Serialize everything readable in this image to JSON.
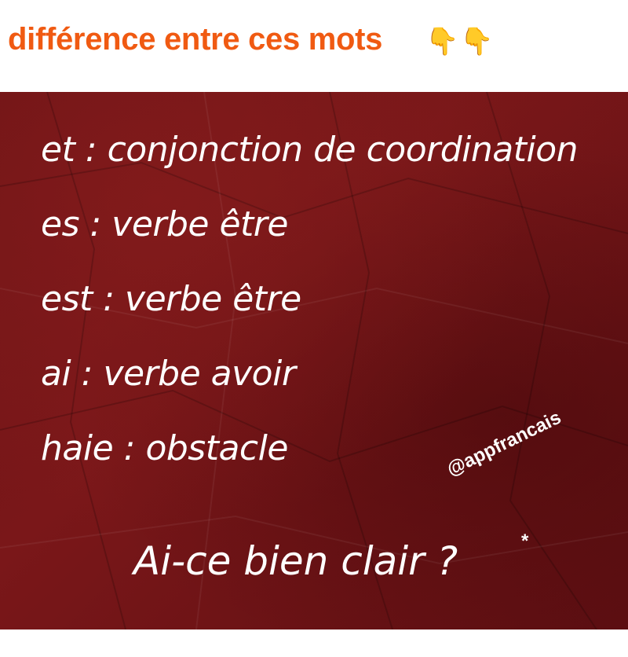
{
  "header": {
    "title": "différence entre ces mots",
    "hands_icon": "pointing-down-hand-emoji"
  },
  "poster": {
    "lines": [
      "et : conjonction de coordination",
      "es : verbe être",
      "est : verbe être",
      "ai : verbe avoir",
      "haie : obstacle"
    ],
    "question": "Ai-ce bien clair ?",
    "asterisk": "*",
    "watermark": "@appfrancais",
    "colors": {
      "background": "#6e1416",
      "text": "#ffffff",
      "title": "#f05a12"
    }
  }
}
